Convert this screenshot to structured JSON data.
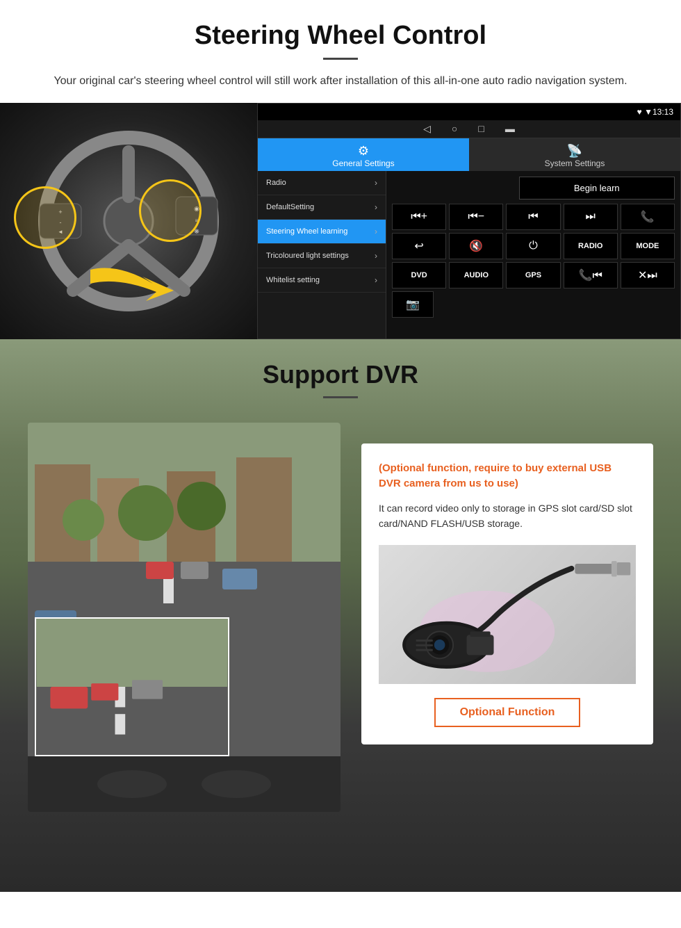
{
  "steering": {
    "title": "Steering Wheel Control",
    "description": "Your original car's steering wheel control will still work after installation of this all-in-one auto radio navigation system.",
    "status_bar": {
      "time": "13:13",
      "icons": "▼ ▲"
    },
    "tabs": {
      "general_label": "General Settings",
      "system_label": "System Settings"
    },
    "menu_items": [
      {
        "label": "Radio",
        "active": false
      },
      {
        "label": "DefaultSetting",
        "active": false
      },
      {
        "label": "Steering Wheel learning",
        "active": true
      },
      {
        "label": "Tricoloured light settings",
        "active": false
      },
      {
        "label": "Whitelist setting",
        "active": false
      }
    ],
    "begin_learn_label": "Begin learn",
    "control_buttons_row1": [
      "⏮+",
      "⏮-",
      "⏮⏮",
      "⏭⏭",
      "📞"
    ],
    "control_buttons_row2": [
      "↩",
      "🔇x",
      "⏻",
      "RADIO",
      "MODE"
    ],
    "control_buttons_row3": [
      "DVD",
      "AUDIO",
      "GPS",
      "📞⏮",
      "✕⏭"
    ],
    "extra_button": "📷"
  },
  "dvr": {
    "title": "Support DVR",
    "optional_text": "(Optional function, require to buy external USB DVR camera from us to use)",
    "description": "It can record video only to storage in GPS slot card/SD slot card/NAND FLASH/USB storage.",
    "optional_function_label": "Optional Function"
  }
}
